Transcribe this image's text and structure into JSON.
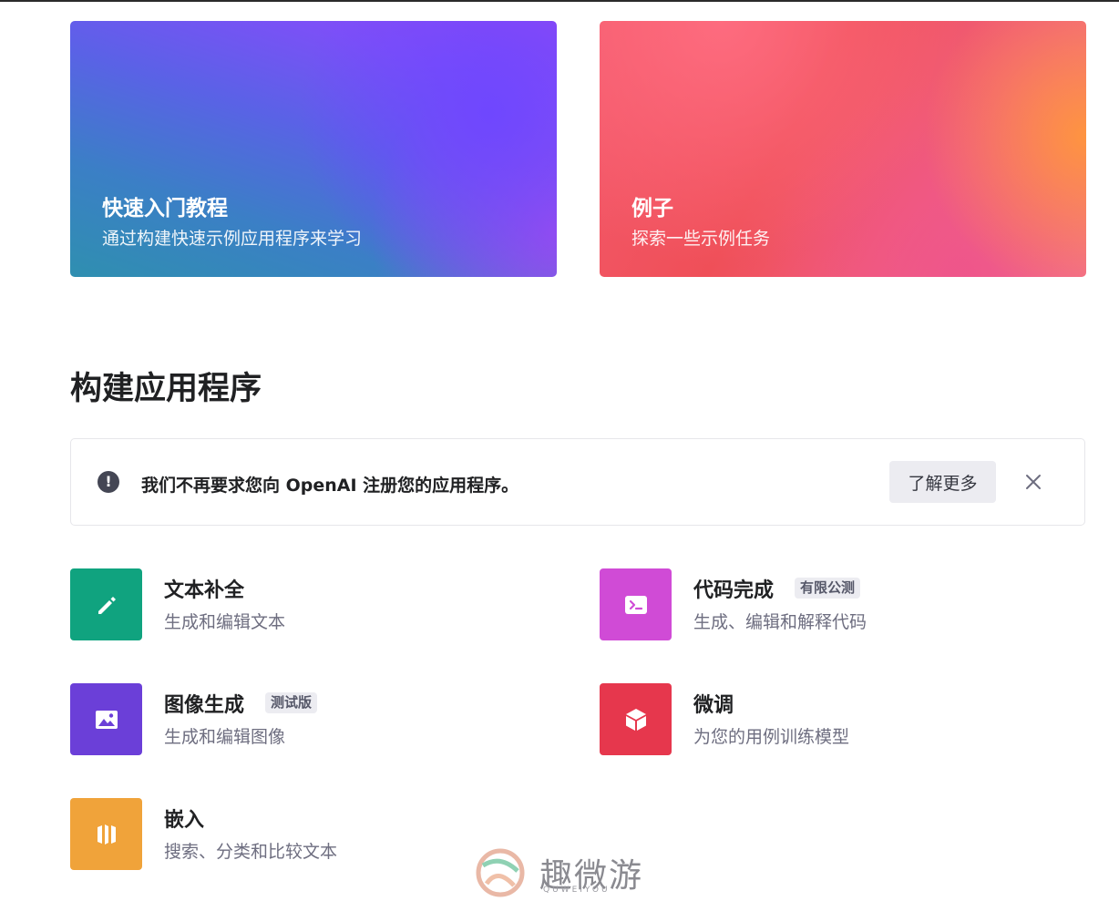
{
  "hero_cards": [
    {
      "title": "快速入门教程",
      "subtitle": "通过构建快速示例应用程序来学习"
    },
    {
      "title": "例子",
      "subtitle": "探索一些示例任务"
    }
  ],
  "section": {
    "title": "构建应用程序"
  },
  "notice": {
    "icon": "exclamation-circle-icon",
    "text": "我们不再要求您向 OpenAI 注册您的应用程序。",
    "button_label": "了解更多",
    "close_icon": "close-icon"
  },
  "features": [
    {
      "title": "文本补全",
      "subtitle": "生成和编辑文本",
      "badge": "",
      "icon": "pencil-icon",
      "color": "#10a37f"
    },
    {
      "title": "代码完成",
      "subtitle": "生成、编辑和解释代码",
      "badge": "有限公测",
      "icon": "terminal-icon",
      "color": "#d04bd6"
    },
    {
      "title": "图像生成",
      "subtitle": "生成和编辑图像",
      "badge": "测试版",
      "icon": "image-icon",
      "color": "#6b3fd8"
    },
    {
      "title": "微调",
      "subtitle": "为您的用例训练模型",
      "badge": "",
      "icon": "cube-icon",
      "color": "#e6374d"
    },
    {
      "title": "嵌入",
      "subtitle": "搜索、分类和比较文本",
      "badge": "",
      "icon": "embeddings-icon",
      "color": "#f0a33a"
    }
  ],
  "watermark": {
    "text": "趣微游",
    "sub": "QUWEIYOU"
  }
}
